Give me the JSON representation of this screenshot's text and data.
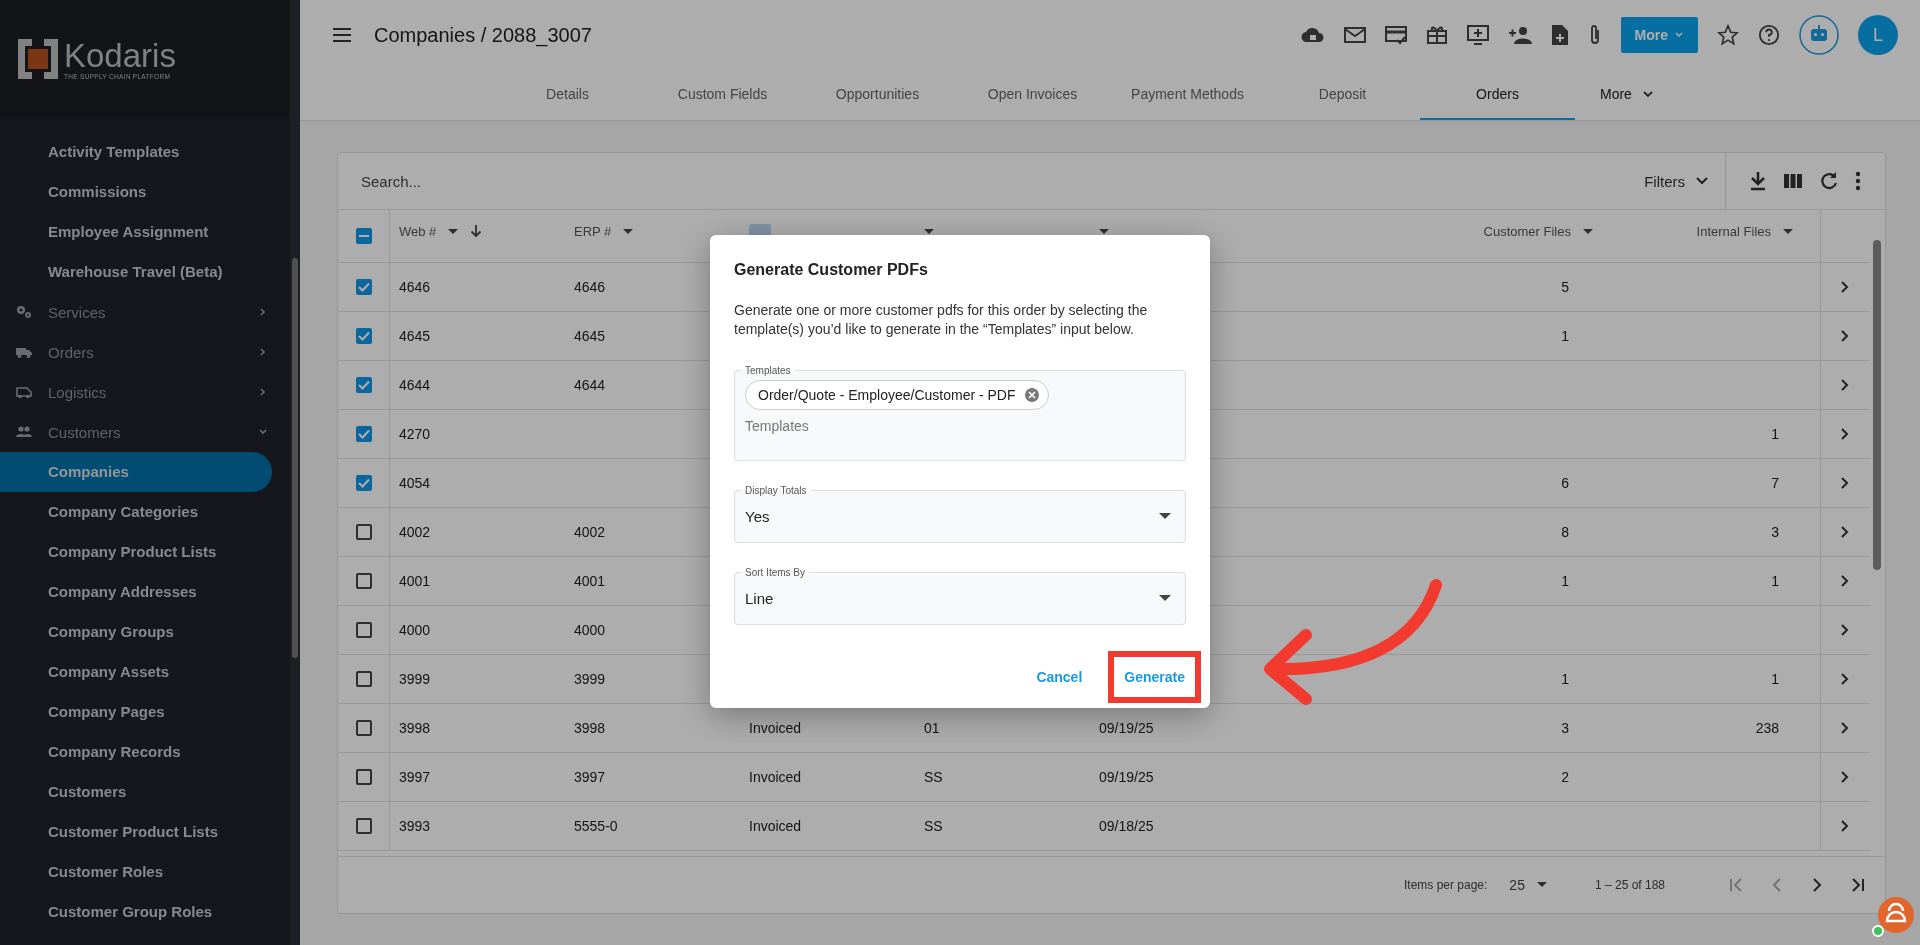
{
  "sidebar": {
    "logo": {
      "name": "Kodaris",
      "tagline": "THE SUPPLY CHAIN PLATFORM"
    },
    "items": [
      {
        "kind": "link",
        "label": "Activity Templates",
        "selected": false
      },
      {
        "kind": "link",
        "label": "Commissions",
        "selected": false
      },
      {
        "kind": "link",
        "label": "Employee Assignment",
        "selected": false
      },
      {
        "kind": "link",
        "label": "Warehouse Travel (Beta)",
        "selected": false
      },
      {
        "kind": "group",
        "label": "Services",
        "expanded": false,
        "selected": false
      },
      {
        "kind": "group",
        "label": "Orders",
        "expanded": false,
        "selected": false
      },
      {
        "kind": "group",
        "label": "Logistics",
        "expanded": false,
        "selected": false
      },
      {
        "kind": "group",
        "label": "Customers",
        "expanded": true,
        "selected": false,
        "children": [
          {
            "kind": "link",
            "label": "Companies",
            "selected": true
          },
          {
            "kind": "link",
            "label": "Company Categories",
            "selected": false
          },
          {
            "kind": "link",
            "label": "Company Product Lists",
            "selected": false
          },
          {
            "kind": "link",
            "label": "Company Addresses",
            "selected": false
          },
          {
            "kind": "link",
            "label": "Company Groups",
            "selected": false
          },
          {
            "kind": "link",
            "label": "Company Assets",
            "selected": false
          },
          {
            "kind": "link",
            "label": "Company Pages",
            "selected": false
          },
          {
            "kind": "link",
            "label": "Company Records",
            "selected": false
          },
          {
            "kind": "link",
            "label": "Customers",
            "selected": false
          },
          {
            "kind": "link",
            "label": "Customer Product Lists",
            "selected": false
          },
          {
            "kind": "link",
            "label": "Customer Roles",
            "selected": false
          },
          {
            "kind": "link",
            "label": "Customer Group Roles",
            "selected": false
          }
        ]
      }
    ]
  },
  "header": {
    "title": "Companies / 2088_3007",
    "more_button": "More",
    "avatar": "L"
  },
  "tabs": [
    {
      "label": "Details",
      "selected": false
    },
    {
      "label": "Custom Fields",
      "selected": false
    },
    {
      "label": "Opportunities",
      "selected": false
    },
    {
      "label": "Open Invoices",
      "selected": false
    },
    {
      "label": "Payment Methods",
      "selected": false
    },
    {
      "label": "Deposit",
      "selected": false
    },
    {
      "label": "Orders",
      "selected": true
    }
  ],
  "more_tab": "More",
  "table": {
    "search": {
      "placeholder": "Search..."
    },
    "filters": "Filters",
    "select_all": {
      "indeterminate": true
    },
    "columns": [
      {
        "label": "Web #",
        "sorted": true,
        "filtered": false
      },
      {
        "label": "ERP #",
        "filtered": false
      },
      {
        "filtered": true
      },
      {
        "filtered": false
      },
      {
        "filtered": false
      },
      {
        "label": "Customer Files",
        "filtered": false
      },
      {
        "label": "Internal Files",
        "filtered": false
      }
    ],
    "rows": [
      {
        "checked": true,
        "web": "4646",
        "erp": "4646",
        "customer_files": "5"
      },
      {
        "checked": true,
        "web": "4645",
        "erp": "4645",
        "customer_files": "1"
      },
      {
        "checked": true,
        "web": "4644",
        "erp": "4644"
      },
      {
        "checked": true,
        "web": "4270",
        "internal_files": "1"
      },
      {
        "checked": true,
        "web": "4054",
        "customer_files": "6",
        "internal_files": "7"
      },
      {
        "checked": false,
        "web": "4002",
        "erp": "4002",
        "customer_files": "8",
        "internal_files": "3"
      },
      {
        "checked": false,
        "web": "4001",
        "erp": "4001",
        "customer_files": "1",
        "internal_files": "1"
      },
      {
        "checked": false,
        "web": "4000",
        "erp": "4000"
      },
      {
        "checked": false,
        "web": "3999",
        "erp": "3999",
        "customer_files": "1",
        "internal_files": "1"
      },
      {
        "checked": false,
        "web": "3998",
        "erp": "3998",
        "status": "Invoiced",
        "warehouse": "01",
        "completed": "09/19/25",
        "customer_files": "3",
        "internal_files": "238"
      },
      {
        "checked": false,
        "web": "3997",
        "erp": "3997",
        "status": "Invoiced",
        "warehouse": "SS",
        "completed": "09/19/25",
        "customer_files": "2"
      },
      {
        "checked": false,
        "web": "3993",
        "erp": "5555-0",
        "status": "Invoiced",
        "warehouse": "SS",
        "completed": "09/18/25"
      }
    ],
    "pagination": {
      "label": "Items per page:",
      "page_size": "25",
      "range": "1 – 25 of 188",
      "first_disabled": true,
      "prev_disabled": true,
      "next_disabled": false,
      "last_disabled": false
    }
  },
  "dialog": {
    "title": "Generate Customer PDFs",
    "description": "Generate one or more customer pdfs for this order by selecting the template(s) you’d like to generate in the “Templates” input below.",
    "templates": {
      "label": "Templates",
      "chips": [
        "Order/Quote - Employee/Customer - PDF"
      ],
      "placeholder": "Templates"
    },
    "selects": [
      {
        "label": "Display Totals",
        "value": "Yes"
      },
      {
        "label": "Sort Items By",
        "value": "Line"
      }
    ],
    "buttons": [
      {
        "kind": "text",
        "label": "Cancel",
        "highlighted": false
      },
      {
        "kind": "text",
        "label": "Generate",
        "highlighted": true
      }
    ]
  }
}
